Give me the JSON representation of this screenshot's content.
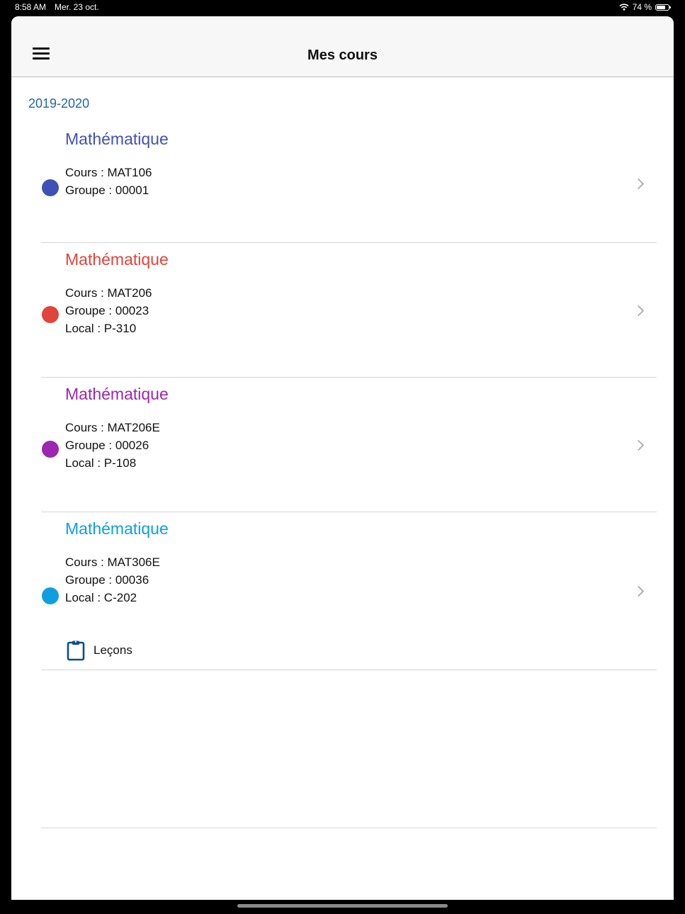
{
  "status_bar": {
    "time": "8:58 AM",
    "date": "Mer. 23 oct.",
    "battery": "74 %",
    "battery_level": 0.74
  },
  "nav": {
    "title": "Mes cours",
    "menu_icon": "hamburger-menu-icon"
  },
  "year": "2019-2020",
  "courses": [
    {
      "title": "Mathématique",
      "color": "#3f51b5",
      "cours": "Cours : MAT106",
      "groupe": "Groupe : 00001"
    },
    {
      "title": "Mathématique",
      "color": "#e0443a",
      "cours": "Cours : MAT206",
      "groupe": "Groupe : 00023",
      "local": "Local : P-310"
    },
    {
      "title": "Mathématique",
      "color": "#9c27b0",
      "cours": "Cours : MAT206E",
      "groupe": "Groupe : 00026",
      "local": "Local : P-108"
    },
    {
      "title": "Mathématique",
      "color": "#0f9ee0",
      "cours": "Cours : MAT306E",
      "groupe": "Groupe : 00036",
      "local": "Local : C-202",
      "action_label": "Leçons",
      "action_icon": "clipboard-icon"
    }
  ],
  "colors": {
    "year": "#1f66a8",
    "clipboard": "#0b4f8c"
  }
}
